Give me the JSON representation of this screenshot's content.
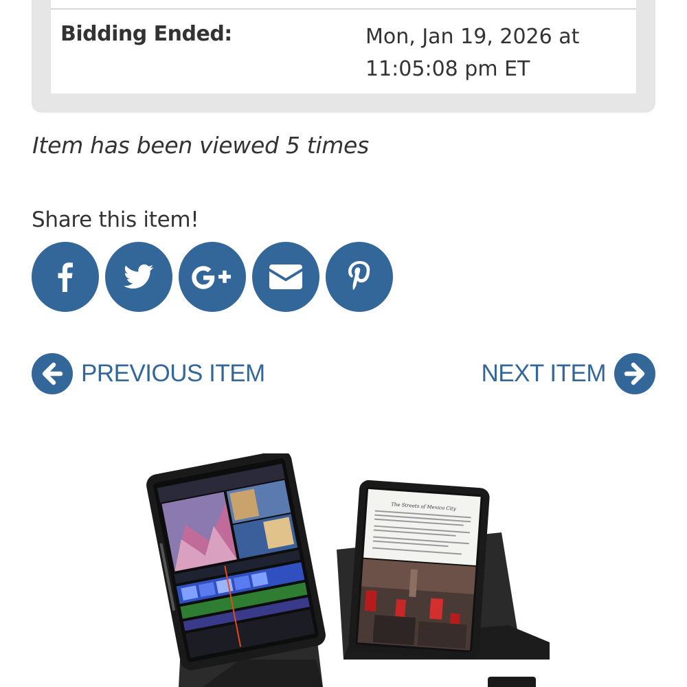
{
  "auction_info": {
    "label": "Bidding Ended:",
    "value": "Mon, Jan 19, 2026 at 11:05:08 pm ET"
  },
  "views_text": "Item has been viewed 5 times",
  "share": {
    "title": "Share this item!",
    "buttons": [
      {
        "network": "Facebook",
        "icon": "facebook-icon"
      },
      {
        "network": "Twitter",
        "icon": "twitter-icon"
      },
      {
        "network": "Google+",
        "icon": "google-plus-icon"
      },
      {
        "network": "Email",
        "icon": "envelope-icon"
      },
      {
        "network": "Pinterest",
        "icon": "pinterest-icon"
      }
    ]
  },
  "navigation": {
    "previous_label": "PREVIOUS ITEM",
    "next_label": "NEXT ITEM"
  },
  "product_image": {
    "screen_heading": "The Streets of Mexico City"
  },
  "colors": {
    "accent": "#336699",
    "panel_background": "#e6e6e6",
    "text": "#333333"
  }
}
